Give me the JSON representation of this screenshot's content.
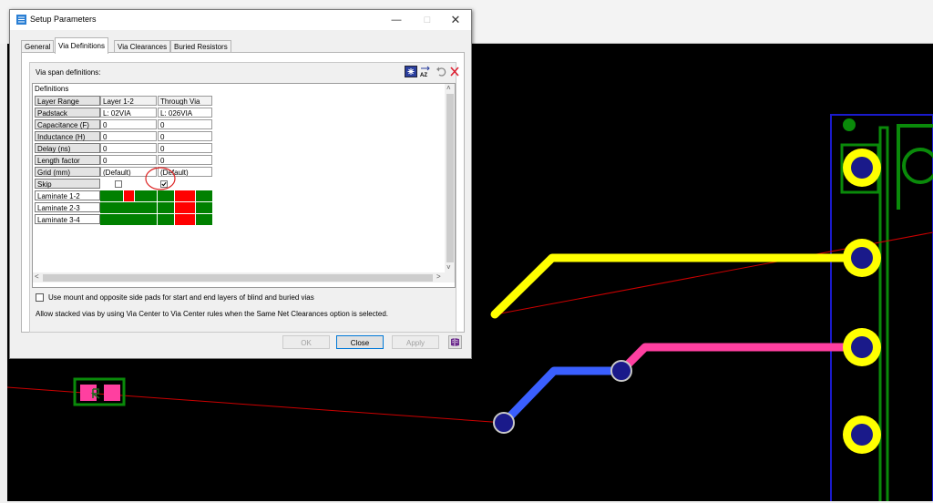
{
  "dialog": {
    "title": "Setup Parameters",
    "tabs": [
      "General",
      "Via Definitions",
      "Via Clearances",
      "Buried Resistors"
    ],
    "active_tab": "Via Definitions"
  },
  "via_defs": {
    "span_label": "Via span definitions:",
    "header": "Definitions",
    "row_labels": [
      "Layer Range",
      "Padstack",
      "Capacitance (F)",
      "Inductance (H)",
      "Delay (ns)",
      "Length factor",
      "Grid (mm)",
      "Skip"
    ],
    "col_a": [
      "Layer 1-2",
      "L: 02VIA",
      "0",
      "0",
      "0",
      "0",
      "(Default)"
    ],
    "col_b": [
      "Through Via",
      "L: 026VIA",
      "0",
      "0",
      "0",
      "0",
      "(Default)"
    ],
    "laminate_labels": [
      "Laminate  1-2",
      "Laminate  2-3",
      "Laminate  3-4"
    ],
    "skip_checked": [
      false,
      true
    ]
  },
  "options": {
    "mount_pads_label": "Use mount and opposite side pads for start and end layers of blind and buried vias",
    "stacked_note": "Allow stacked vias by using Via Center to Via Center rules when the Same Net Clearances option is selected."
  },
  "buttons": {
    "ok": "OK",
    "close": "Close",
    "apply": "Apply"
  },
  "colors": {
    "enabled_layer": "#008000",
    "disabled_layer": "#ff0000",
    "canvas": "#000000",
    "trace_yellow": "#ffff00",
    "trace_pink": "#ff3fa0",
    "trace_blue": "#3a5fff",
    "outline_blue": "#1a1acc",
    "outline_green": "#0a8a0a"
  },
  "icons": [
    "setup-app-icon",
    "add-via-icon",
    "sort-az-icon",
    "undo-icon",
    "delete-icon",
    "help-book-icon"
  ]
}
